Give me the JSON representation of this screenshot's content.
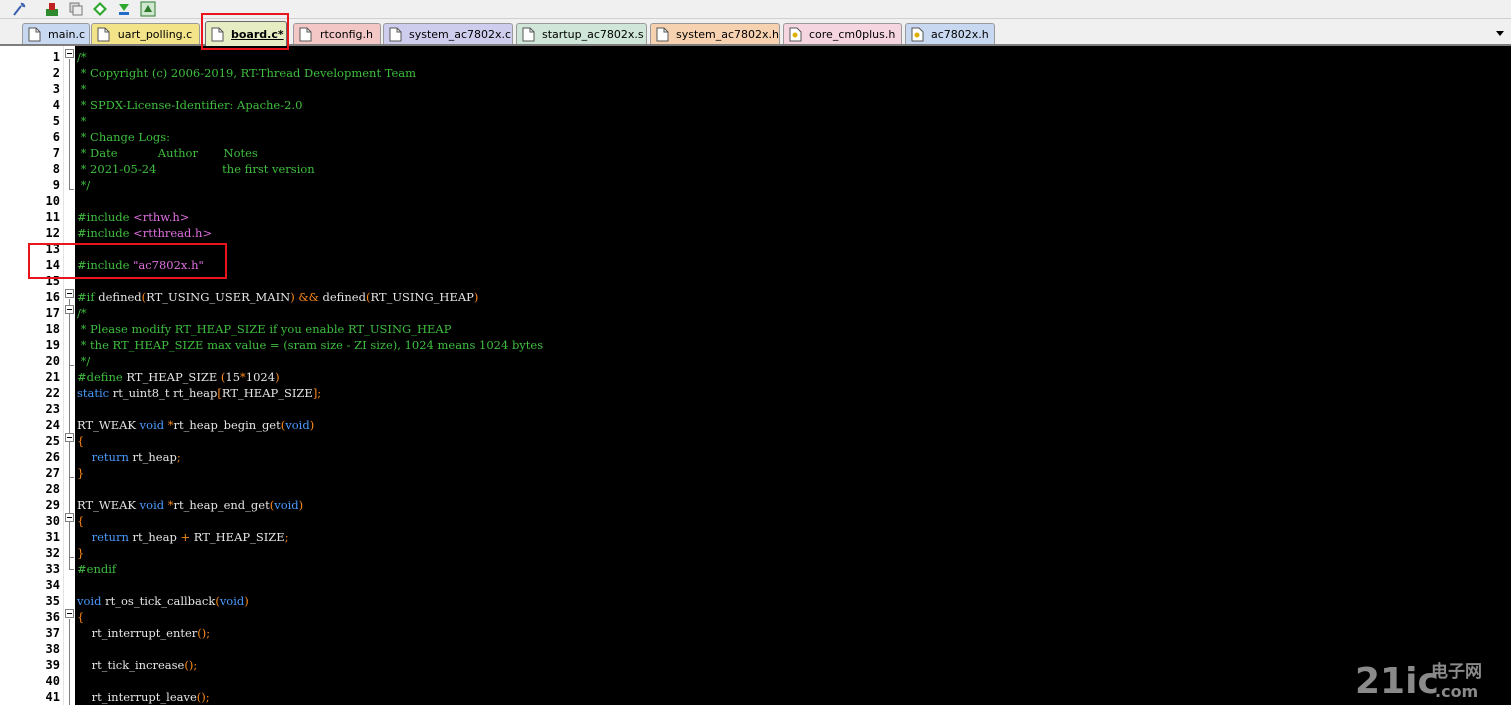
{
  "tabs": [
    {
      "label": "main.c",
      "color": "#c8d8f0"
    },
    {
      "label": "uart_polling.c",
      "color": "#f3e48a"
    },
    {
      "label": "board.c*",
      "color": "#e6edc3",
      "active": true
    },
    {
      "label": "rtconfig.h",
      "color": "#f4c7c7"
    },
    {
      "label": "system_ac7802x.c",
      "color": "#cfcdee"
    },
    {
      "label": "startup_ac7802x.s",
      "color": "#cfe6d8"
    },
    {
      "label": "system_ac7802x.h",
      "color": "#f6d2b0"
    },
    {
      "label": "core_cm0plus.h",
      "color": "#f5d6e0"
    },
    {
      "label": "ac7802x.h",
      "color": "#c8d8f0"
    }
  ],
  "lines": [
    {
      "n": "1",
      "parts": [
        [
          "c-comment",
          "/*"
        ]
      ]
    },
    {
      "n": "2",
      "parts": [
        [
          "c-comment",
          " * Copyright (c) 2006-2019, RT-Thread Development Team"
        ]
      ]
    },
    {
      "n": "3",
      "parts": [
        [
          "c-comment",
          " *"
        ]
      ]
    },
    {
      "n": "4",
      "parts": [
        [
          "c-comment",
          " * SPDX-License-Identifier: Apache-2.0"
        ]
      ]
    },
    {
      "n": "5",
      "parts": [
        [
          "c-comment",
          " *"
        ]
      ]
    },
    {
      "n": "6",
      "parts": [
        [
          "c-comment",
          " * Change Logs:"
        ]
      ]
    },
    {
      "n": "7",
      "parts": [
        [
          "c-comment",
          " * Date           Author       Notes"
        ]
      ]
    },
    {
      "n": "8",
      "parts": [
        [
          "c-comment",
          " * 2021-05-24                  the first version"
        ]
      ]
    },
    {
      "n": "9",
      "parts": [
        [
          "c-comment",
          " */"
        ]
      ]
    },
    {
      "n": "10",
      "parts": []
    },
    {
      "n": "11",
      "parts": [
        [
          "c-pp",
          "#include "
        ],
        [
          "c-str",
          "<rthw.h>"
        ]
      ]
    },
    {
      "n": "12",
      "parts": [
        [
          "c-pp",
          "#include "
        ],
        [
          "c-str",
          "<rtthread.h>"
        ]
      ]
    },
    {
      "n": "13",
      "parts": []
    },
    {
      "n": "14",
      "parts": [
        [
          "c-pp",
          "#include "
        ],
        [
          "c-str",
          "\"ac7802x.h\""
        ]
      ]
    },
    {
      "n": "15",
      "parts": []
    },
    {
      "n": "16",
      "parts": [
        [
          "c-pp",
          "#if "
        ],
        [
          "c-txt",
          "defined"
        ],
        [
          "c-op",
          "("
        ],
        [
          "c-txt",
          "RT_USING_USER_MAIN"
        ],
        [
          "c-op",
          ")"
        ],
        [
          "c-txt",
          " "
        ],
        [
          "c-op",
          "&&"
        ],
        [
          "c-txt",
          " defined"
        ],
        [
          "c-op",
          "("
        ],
        [
          "c-txt",
          "RT_USING_HEAP"
        ],
        [
          "c-op",
          ")"
        ]
      ]
    },
    {
      "n": "17",
      "parts": [
        [
          "c-comment",
          "/*"
        ]
      ]
    },
    {
      "n": "18",
      "parts": [
        [
          "c-comment",
          " * Please modify RT_HEAP_SIZE if you enable RT_USING_HEAP"
        ]
      ]
    },
    {
      "n": "19",
      "parts": [
        [
          "c-comment",
          " * the RT_HEAP_SIZE max value = (sram size - ZI size), 1024 means 1024 bytes"
        ]
      ]
    },
    {
      "n": "20",
      "parts": [
        [
          "c-comment",
          " */"
        ]
      ]
    },
    {
      "n": "21",
      "parts": [
        [
          "c-pp",
          "#define "
        ],
        [
          "c-txt",
          "RT_HEAP_SIZE "
        ],
        [
          "c-op",
          "("
        ],
        [
          "c-txt",
          "15"
        ],
        [
          "c-op",
          "*"
        ],
        [
          "c-txt",
          "1024"
        ],
        [
          "c-op",
          ")"
        ]
      ]
    },
    {
      "n": "22",
      "parts": [
        [
          "c-kw",
          "static "
        ],
        [
          "c-txt",
          "rt_uint8_t rt_heap"
        ],
        [
          "c-op",
          "["
        ],
        [
          "c-txt",
          "RT_HEAP_SIZE"
        ],
        [
          "c-op",
          "];"
        ]
      ]
    },
    {
      "n": "23",
      "parts": []
    },
    {
      "n": "24",
      "parts": [
        [
          "c-txt",
          "RT_WEAK "
        ],
        [
          "c-kw",
          "void "
        ],
        [
          "c-op",
          "*"
        ],
        [
          "c-txt",
          "rt_heap_begin_get"
        ],
        [
          "c-op",
          "("
        ],
        [
          "c-kw",
          "void"
        ],
        [
          "c-op",
          ")"
        ]
      ]
    },
    {
      "n": "25",
      "parts": [
        [
          "c-op",
          "{"
        ]
      ]
    },
    {
      "n": "26",
      "parts": [
        [
          "c-txt",
          "    "
        ],
        [
          "c-kw",
          "return "
        ],
        [
          "c-txt",
          "rt_heap"
        ],
        [
          "c-op",
          ";"
        ]
      ]
    },
    {
      "n": "27",
      "parts": [
        [
          "c-op",
          "}"
        ]
      ]
    },
    {
      "n": "28",
      "parts": []
    },
    {
      "n": "29",
      "parts": [
        [
          "c-txt",
          "RT_WEAK "
        ],
        [
          "c-kw",
          "void "
        ],
        [
          "c-op",
          "*"
        ],
        [
          "c-txt",
          "rt_heap_end_get"
        ],
        [
          "c-op",
          "("
        ],
        [
          "c-kw",
          "void"
        ],
        [
          "c-op",
          ")"
        ]
      ]
    },
    {
      "n": "30",
      "parts": [
        [
          "c-op",
          "{"
        ]
      ]
    },
    {
      "n": "31",
      "parts": [
        [
          "c-txt",
          "    "
        ],
        [
          "c-kw",
          "return "
        ],
        [
          "c-txt",
          "rt_heap "
        ],
        [
          "c-op",
          "+"
        ],
        [
          "c-txt",
          " RT_HEAP_SIZE"
        ],
        [
          "c-op",
          ";"
        ]
      ]
    },
    {
      "n": "32",
      "parts": [
        [
          "c-op",
          "}"
        ]
      ]
    },
    {
      "n": "33",
      "parts": [
        [
          "c-pp",
          "#endif"
        ]
      ]
    },
    {
      "n": "34",
      "parts": []
    },
    {
      "n": "35",
      "parts": [
        [
          "c-kw",
          "void "
        ],
        [
          "c-txt",
          "rt_os_tick_callback"
        ],
        [
          "c-op",
          "("
        ],
        [
          "c-kw",
          "void"
        ],
        [
          "c-op",
          ")"
        ]
      ]
    },
    {
      "n": "36",
      "parts": [
        [
          "c-op",
          "{"
        ]
      ]
    },
    {
      "n": "37",
      "parts": [
        [
          "c-txt",
          "    rt_interrupt_enter"
        ],
        [
          "c-op",
          "();"
        ]
      ]
    },
    {
      "n": "38",
      "parts": []
    },
    {
      "n": "39",
      "parts": [
        [
          "c-txt",
          "    rt_tick_increase"
        ],
        [
          "c-op",
          "();"
        ]
      ]
    },
    {
      "n": "40",
      "parts": []
    },
    {
      "n": "41",
      "parts": [
        [
          "c-txt",
          "    rt_interrupt_leave"
        ],
        [
          "c-op",
          "();"
        ]
      ]
    }
  ],
  "watermark": {
    "brand": "21ic",
    "cn": "电子网",
    "domain": ".com"
  }
}
